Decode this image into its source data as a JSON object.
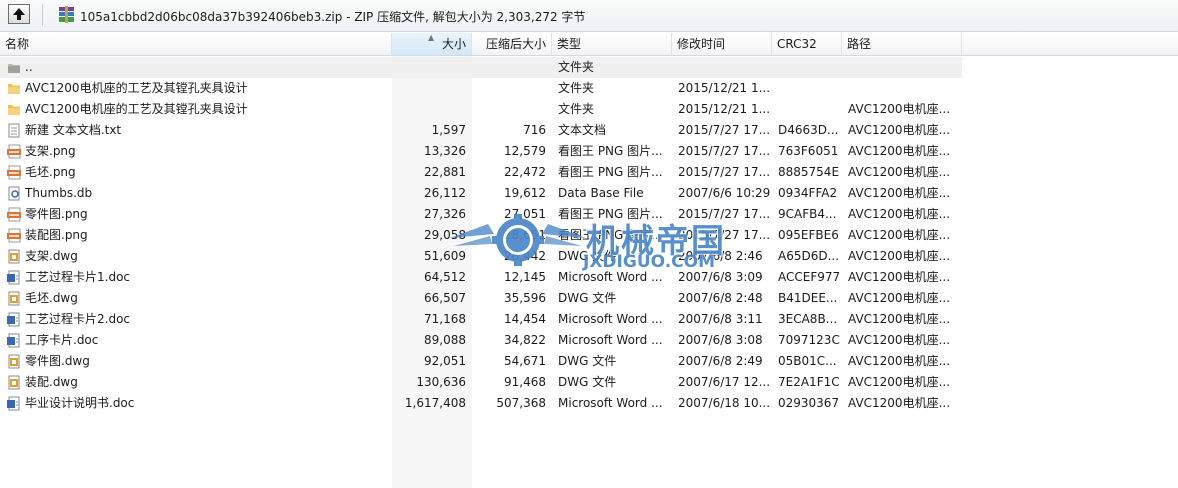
{
  "toolbar": {
    "title": "105a1cbbd2d06bc08da37b392406beb3.zip - ZIP 压缩文件, 解包大小为 2,303,272 字节"
  },
  "columns": {
    "name": "名称",
    "size": "大小",
    "packed": "压缩后大小",
    "type": "类型",
    "modified": "修改时间",
    "crc": "CRC32",
    "path": "路径"
  },
  "files": [
    {
      "icon": "folder-up-icon",
      "name": "..",
      "size": "",
      "packed": "",
      "type": "文件夹",
      "modified": "",
      "crc": "",
      "path": ""
    },
    {
      "icon": "folder-icon",
      "name": "AVC1200电机座的工艺及其镗孔夹具设计",
      "size": "",
      "packed": "",
      "type": "文件夹",
      "modified": "2015/12/21 1...",
      "crc": "",
      "path": ""
    },
    {
      "icon": "folder-icon",
      "name": "AVC1200电机座的工艺及其镗孔夹具设计",
      "size": "",
      "packed": "",
      "type": "文件夹",
      "modified": "2015/12/21 1...",
      "crc": "",
      "path": "AVC1200电机座..."
    },
    {
      "icon": "txt-file-icon",
      "name": "新建 文本文档.txt",
      "size": "1,597",
      "packed": "716",
      "type": "文本文档",
      "modified": "2015/7/27 17...",
      "crc": "D4663D...",
      "path": "AVC1200电机座..."
    },
    {
      "icon": "png-file-icon",
      "name": "支架.png",
      "size": "13,326",
      "packed": "12,579",
      "type": "看图王 PNG 图片...",
      "modified": "2015/7/27 17...",
      "crc": "763F6051",
      "path": "AVC1200电机座..."
    },
    {
      "icon": "png-file-icon",
      "name": "毛坯.png",
      "size": "22,881",
      "packed": "22,472",
      "type": "看图王 PNG 图片...",
      "modified": "2015/7/27 17...",
      "crc": "8885754E",
      "path": "AVC1200电机座..."
    },
    {
      "icon": "db-file-icon",
      "name": "Thumbs.db",
      "size": "26,112",
      "packed": "19,612",
      "type": "Data Base File",
      "modified": "2007/6/6 10:29",
      "crc": "0934FFA2",
      "path": "AVC1200电机座..."
    },
    {
      "icon": "png-file-icon",
      "name": "零件图.png",
      "size": "27,326",
      "packed": "27,051",
      "type": "看图王 PNG 图片...",
      "modified": "2015/7/27 17...",
      "crc": "9CAFB4...",
      "path": "AVC1200电机座..."
    },
    {
      "icon": "png-file-icon",
      "name": "装配图.png",
      "size": "29,058",
      "packed": "28,651",
      "type": "看图王 PNG 图片...",
      "modified": "2015/7/27 17...",
      "crc": "095EFBE6",
      "path": "AVC1200电机座..."
    },
    {
      "icon": "dwg-file-icon",
      "name": "支架.dwg",
      "size": "51,609",
      "packed": "28,442",
      "type": "DWG 文件",
      "modified": "2007/6/8 2:46",
      "crc": "A65D6D...",
      "path": "AVC1200电机座..."
    },
    {
      "icon": "doc-file-icon",
      "name": "工艺过程卡片1.doc",
      "size": "64,512",
      "packed": "12,145",
      "type": "Microsoft Word ...",
      "modified": "2007/6/8 3:09",
      "crc": "ACCEF977",
      "path": "AVC1200电机座..."
    },
    {
      "icon": "dwg-file-icon",
      "name": "毛坯.dwg",
      "size": "66,507",
      "packed": "35,596",
      "type": "DWG 文件",
      "modified": "2007/6/8 2:48",
      "crc": "B41DEE...",
      "path": "AVC1200电机座..."
    },
    {
      "icon": "doc-file-icon",
      "name": "工艺过程卡片2.doc",
      "size": "71,168",
      "packed": "14,454",
      "type": "Microsoft Word ...",
      "modified": "2007/6/8 3:11",
      "crc": "3ECA8B...",
      "path": "AVC1200电机座..."
    },
    {
      "icon": "doc-file-icon",
      "name": "工序卡片.doc",
      "size": "89,088",
      "packed": "34,822",
      "type": "Microsoft Word ...",
      "modified": "2007/6/8 3:08",
      "crc": "7097123C",
      "path": "AVC1200电机座..."
    },
    {
      "icon": "dwg-file-icon",
      "name": "零件图.dwg",
      "size": "92,051",
      "packed": "54,671",
      "type": "DWG 文件",
      "modified": "2007/6/8 2:49",
      "crc": "05B01C...",
      "path": "AVC1200电机座..."
    },
    {
      "icon": "dwg-file-icon",
      "name": "装配.dwg",
      "size": "130,636",
      "packed": "91,468",
      "type": "DWG 文件",
      "modified": "2007/6/17 12...",
      "crc": "7E2A1F1C",
      "path": "AVC1200电机座..."
    },
    {
      "icon": "doc-file-icon",
      "name": "毕业设计说明书.doc",
      "size": "1,617,408",
      "packed": "507,368",
      "type": "Microsoft Word ...",
      "modified": "2007/6/18 10...",
      "crc": "02930367",
      "path": "AVC1200电机座..."
    }
  ],
  "watermark": {
    "chinese": "机械帝国",
    "english": "JXDIGUO.COM"
  },
  "colors": {
    "folder": "#e8c15a",
    "png_badge": "#d9763a",
    "doc_blue": "#3a67b5",
    "dwg_orange": "#e0a030",
    "watermark_blue": "#4a86c8"
  }
}
